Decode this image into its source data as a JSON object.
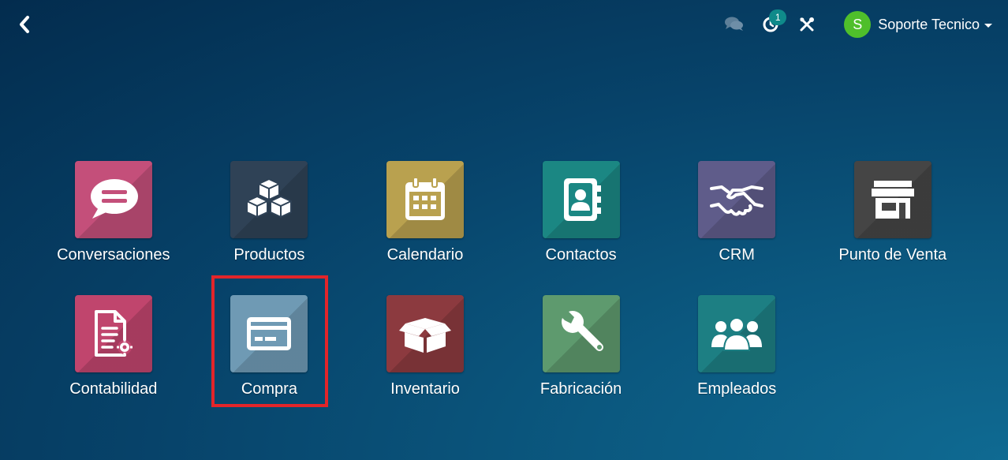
{
  "topbar": {
    "back_icon": "chevron-left-icon",
    "chat_icon": "comments-icon",
    "activity_icon": "clock-icon",
    "activity_count": "1",
    "debug_icon": "tools-icon",
    "user": {
      "initial": "S",
      "name": "Soporte Tecnico",
      "avatar_color": "#4fbf2b"
    }
  },
  "apps": [
    {
      "label": "Conversaciones",
      "icon": "chat-bubble-icon",
      "color": "#c44f7a"
    },
    {
      "label": "Productos",
      "icon": "cubes-icon",
      "color": "#2f4256"
    },
    {
      "label": "Calendario",
      "icon": "calendar-icon",
      "color": "#b9a14f"
    },
    {
      "label": "Contactos",
      "icon": "address-book-icon",
      "color": "#1b8783"
    },
    {
      "label": "CRM",
      "icon": "handshake-icon",
      "color": "#5f5c8a"
    },
    {
      "label": "Punto de Venta",
      "icon": "store-icon",
      "color": "#454545"
    },
    {
      "label": "Contabilidad",
      "icon": "invoice-icon",
      "color": "#c0456d"
    },
    {
      "label": "Compra",
      "icon": "credit-card-icon",
      "color": "#6f9ab4"
    },
    {
      "label": "Inventario",
      "icon": "open-box-icon",
      "color": "#8c3a3f"
    },
    {
      "label": "Fabricación",
      "icon": "wrench-icon",
      "color": "#5e9a6e"
    },
    {
      "label": "Empleados",
      "icon": "users-icon",
      "color": "#1d7f83"
    }
  ],
  "highlight": {
    "target": "Compra",
    "color": "#e3252a"
  }
}
